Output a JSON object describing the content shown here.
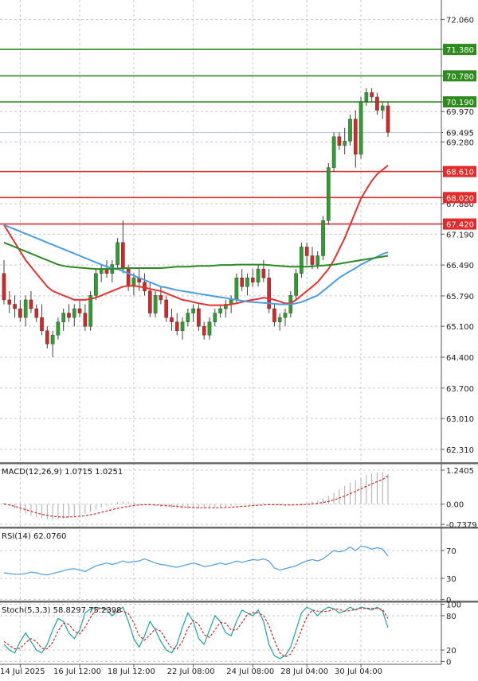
{
  "colors": {
    "background": "#ffffff",
    "grid": "#c8c8c8",
    "bull_candle": "#2ca02c",
    "bear_candle": "#d62728",
    "wick": "#404040",
    "ma_fast": "#e8322e",
    "ma_mid": "#4a9de0",
    "ma_slow": "#2a8a22",
    "resistance_line": "#2e8b1e",
    "support_line": "#e32b2b",
    "current_price_line": "#b8c8dc",
    "macd_hist": "#aaaaaa",
    "macd_signal": "#d62728",
    "rsi_line": "#4a9de0",
    "stoch_k": "#1aa3a3",
    "stoch_d": "#d62728"
  },
  "chart_data": {
    "type": "candlestick",
    "main": {
      "ylim": [
        62.0,
        72.5
      ],
      "y_ticks": [
        "72.060",
        "71.380",
        "70.780",
        "70.190",
        "69.970",
        "69.495",
        "69.280",
        "68.610",
        "68.020",
        "67.880",
        "67.420",
        "67.190",
        "66.490",
        "65.790",
        "65.100",
        "64.400",
        "63.700",
        "63.010",
        "62.310"
      ],
      "y_tick_values": [
        72.06,
        71.38,
        70.78,
        70.19,
        69.97,
        69.495,
        69.28,
        68.61,
        68.02,
        67.88,
        67.42,
        67.19,
        66.49,
        65.79,
        65.1,
        64.4,
        63.7,
        63.01,
        62.31
      ],
      "resistance_levels": [
        {
          "label": "71.380",
          "value": 71.38
        },
        {
          "label": "70.780",
          "value": 70.78
        },
        {
          "label": "70.190",
          "value": 70.19
        }
      ],
      "support_levels": [
        {
          "label": "68.610",
          "value": 68.61
        },
        {
          "label": "68.020",
          "value": 68.02
        },
        {
          "label": "67.420",
          "value": 67.42
        }
      ],
      "current_price": {
        "label": "69.495",
        "value": 69.495
      },
      "candles": [
        [
          66.3,
          66.6,
          65.6,
          65.7
        ],
        [
          65.7,
          65.9,
          65.4,
          65.6
        ],
        [
          65.6,
          65.8,
          65.3,
          65.5
        ],
        [
          65.5,
          65.7,
          65.2,
          65.3
        ],
        [
          65.3,
          65.8,
          65.1,
          65.7
        ],
        [
          65.7,
          65.9,
          65.4,
          65.5
        ],
        [
          65.5,
          65.6,
          65.2,
          65.3
        ],
        [
          65.3,
          65.6,
          64.9,
          65.0
        ],
        [
          65.0,
          65.1,
          64.6,
          64.7
        ],
        [
          64.7,
          65.0,
          64.4,
          64.9
        ],
        [
          64.9,
          65.3,
          64.8,
          65.2
        ],
        [
          65.2,
          65.5,
          65.0,
          65.4
        ],
        [
          65.4,
          65.6,
          65.2,
          65.3
        ],
        [
          65.3,
          65.6,
          65.1,
          65.5
        ],
        [
          65.5,
          65.7,
          65.3,
          65.4
        ],
        [
          65.4,
          65.6,
          65.0,
          65.1
        ],
        [
          65.1,
          65.9,
          65.0,
          65.8
        ],
        [
          65.8,
          66.4,
          65.7,
          66.3
        ],
        [
          66.3,
          66.5,
          66.1,
          66.4
        ],
        [
          66.4,
          66.6,
          66.2,
          66.3
        ],
        [
          66.3,
          66.6,
          66.1,
          66.5
        ],
        [
          66.5,
          67.1,
          66.4,
          67.0
        ],
        [
          67.0,
          67.5,
          66.3,
          66.4
        ],
        [
          66.4,
          66.5,
          65.9,
          66.0
        ],
        [
          66.0,
          66.3,
          65.8,
          66.2
        ],
        [
          66.2,
          66.4,
          65.9,
          66.1
        ],
        [
          66.1,
          66.3,
          65.8,
          65.9
        ],
        [
          65.9,
          66.1,
          65.3,
          65.4
        ],
        [
          65.4,
          65.9,
          65.3,
          65.8
        ],
        [
          65.8,
          66.0,
          65.6,
          65.7
        ],
        [
          65.7,
          65.8,
          65.2,
          65.3
        ],
        [
          65.3,
          65.5,
          65.0,
          65.2
        ],
        [
          65.2,
          65.4,
          64.9,
          65.0
        ],
        [
          65.0,
          65.3,
          64.8,
          65.2
        ],
        [
          65.2,
          65.5,
          65.1,
          65.4
        ],
        [
          65.4,
          65.6,
          65.2,
          65.5
        ],
        [
          65.5,
          65.6,
          65.0,
          65.1
        ],
        [
          65.1,
          65.2,
          64.8,
          64.9
        ],
        [
          64.9,
          65.3,
          64.8,
          65.2
        ],
        [
          65.2,
          65.5,
          65.1,
          65.4
        ],
        [
          65.4,
          65.6,
          65.3,
          65.5
        ],
        [
          65.5,
          65.7,
          65.3,
          65.6
        ],
        [
          65.6,
          65.8,
          65.4,
          65.7
        ],
        [
          65.7,
          66.3,
          65.6,
          66.2
        ],
        [
          66.2,
          66.4,
          65.9,
          66.0
        ],
        [
          66.0,
          66.3,
          65.8,
          66.2
        ],
        [
          66.2,
          66.4,
          66.0,
          66.1
        ],
        [
          66.1,
          66.5,
          66.0,
          66.4
        ],
        [
          66.4,
          66.6,
          66.1,
          66.2
        ],
        [
          66.2,
          66.4,
          65.4,
          65.5
        ],
        [
          65.5,
          65.6,
          65.1,
          65.2
        ],
        [
          65.2,
          65.4,
          65.0,
          65.3
        ],
        [
          65.3,
          65.5,
          65.1,
          65.4
        ],
        [
          65.4,
          65.9,
          65.3,
          65.8
        ],
        [
          65.8,
          66.4,
          65.7,
          66.3
        ],
        [
          66.3,
          67.0,
          66.2,
          66.9
        ],
        [
          66.9,
          67.0,
          66.5,
          66.7
        ],
        [
          66.7,
          66.9,
          66.4,
          66.5
        ],
        [
          66.5,
          66.8,
          66.4,
          66.7
        ],
        [
          66.7,
          67.6,
          66.6,
          67.5
        ],
        [
          67.5,
          68.8,
          67.4,
          68.7
        ],
        [
          68.7,
          69.5,
          68.6,
          69.4
        ],
        [
          69.4,
          69.5,
          69.1,
          69.2
        ],
        [
          69.2,
          69.6,
          69.0,
          69.3
        ],
        [
          69.3,
          69.9,
          69.2,
          69.8
        ],
        [
          69.8,
          70.0,
          68.7,
          69.0
        ],
        [
          69.0,
          70.3,
          68.9,
          70.2
        ],
        [
          70.2,
          70.5,
          70.1,
          70.4
        ],
        [
          70.4,
          70.5,
          70.2,
          70.3
        ],
        [
          70.3,
          70.4,
          69.9,
          70.0
        ],
        [
          70.0,
          70.2,
          69.8,
          70.1
        ],
        [
          70.1,
          70.2,
          69.4,
          69.5
        ]
      ],
      "moving_averages": [
        {
          "key": "ma_fast",
          "values": [
            67.4,
            67.2,
            67.0,
            66.8,
            66.6,
            66.45,
            66.3,
            66.15,
            66.0,
            65.9,
            65.85,
            65.8,
            65.75,
            65.7,
            65.7,
            65.7,
            65.72,
            65.75,
            65.8,
            65.85,
            65.9,
            65.95,
            66.0,
            66.02,
            66.02,
            66.0,
            65.98,
            65.95,
            65.92,
            65.9,
            65.85,
            65.8,
            65.75,
            65.7,
            65.68,
            65.65,
            65.62,
            65.6,
            65.58,
            65.58,
            65.58,
            65.58,
            65.6,
            65.62,
            65.65,
            65.68,
            65.7,
            65.72,
            65.75,
            65.73,
            65.7,
            65.66,
            65.62,
            65.62,
            65.7,
            65.8,
            65.9,
            66.0,
            66.1,
            66.25,
            66.4,
            66.6,
            66.85,
            67.1,
            67.4,
            67.7,
            68.0,
            68.2,
            68.4,
            68.55,
            68.65,
            68.75
          ]
        },
        {
          "key": "ma_mid",
          "values": [
            67.4,
            67.35,
            67.3,
            67.25,
            67.2,
            67.15,
            67.1,
            67.05,
            67.0,
            66.95,
            66.9,
            66.85,
            66.8,
            66.75,
            66.7,
            66.65,
            66.6,
            66.55,
            66.5,
            66.45,
            66.42,
            66.4,
            66.35,
            66.3,
            66.25,
            66.2,
            66.15,
            66.1,
            66.05,
            66.0,
            65.98,
            65.95,
            65.92,
            65.9,
            65.88,
            65.86,
            65.84,
            65.82,
            65.8,
            65.78,
            65.76,
            65.74,
            65.72,
            65.7,
            65.68,
            65.66,
            65.65,
            65.64,
            65.63,
            65.62,
            65.61,
            65.6,
            65.6,
            65.6,
            65.62,
            65.65,
            65.7,
            65.75,
            65.8,
            65.9,
            66.0,
            66.1,
            66.2,
            66.28,
            66.35,
            66.42,
            66.5,
            66.56,
            66.62,
            66.68,
            66.74,
            66.78
          ]
        },
        {
          "key": "ma_slow",
          "values": [
            67.0,
            66.95,
            66.9,
            66.85,
            66.8,
            66.75,
            66.7,
            66.65,
            66.6,
            66.55,
            66.5,
            66.47,
            66.45,
            66.44,
            66.43,
            66.42,
            66.41,
            66.4,
            66.4,
            66.4,
            66.4,
            66.41,
            66.42,
            66.42,
            66.42,
            66.42,
            66.42,
            66.42,
            66.42,
            66.42,
            66.43,
            66.44,
            66.45,
            66.45,
            66.45,
            66.46,
            66.47,
            66.47,
            66.47,
            66.48,
            66.49,
            66.49,
            66.49,
            66.5,
            66.5,
            66.5,
            66.5,
            66.5,
            66.5,
            66.49,
            66.48,
            66.47,
            66.46,
            66.45,
            66.45,
            66.45,
            66.45,
            66.46,
            66.47,
            66.48,
            66.49,
            66.5,
            66.52,
            66.54,
            66.56,
            66.58,
            66.6,
            66.62,
            66.64,
            66.66,
            66.68,
            66.7
          ]
        }
      ]
    },
    "x_ticks": [
      {
        "label": "14 Jul 2025",
        "index": 3
      },
      {
        "label": "16 Jul 12:00",
        "index": 14
      },
      {
        "label": "18 Jul 12:00",
        "index": 24
      },
      {
        "label": "22 Jul 08:00",
        "index": 35
      },
      {
        "label": "24 Jul 08:00",
        "index": 46
      },
      {
        "label": "28 Jul 04:00",
        "index": 56
      },
      {
        "label": "30 Jul 04:00",
        "index": 66
      }
    ],
    "macd": {
      "label": "MACD(12,26,9) 1.0715 1.0251",
      "ylim": [
        -0.85,
        1.5
      ],
      "y_ticks": [
        "1.2405",
        "0.00",
        "-0.7379"
      ],
      "y_tick_values": [
        1.2405,
        0.0,
        -0.7379
      ],
      "hist": [
        0.05,
        -0.05,
        -0.15,
        -0.25,
        -0.35,
        -0.42,
        -0.48,
        -0.52,
        -0.55,
        -0.56,
        -0.55,
        -0.52,
        -0.48,
        -0.44,
        -0.4,
        -0.35,
        -0.28,
        -0.2,
        -0.12,
        -0.05,
        0.02,
        0.08,
        0.1,
        0.08,
        0.05,
        0.02,
        -0.02,
        -0.05,
        -0.08,
        -0.1,
        -0.12,
        -0.14,
        -0.15,
        -0.16,
        -0.17,
        -0.17,
        -0.17,
        -0.16,
        -0.15,
        -0.13,
        -0.11,
        -0.09,
        -0.07,
        -0.04,
        -0.02,
        0.0,
        0.02,
        0.03,
        0.04,
        0.02,
        -0.02,
        -0.05,
        -0.06,
        -0.05,
        -0.02,
        0.02,
        0.06,
        0.1,
        0.14,
        0.2,
        0.3,
        0.42,
        0.54,
        0.66,
        0.78,
        0.88,
        0.98,
        1.06,
        1.12,
        1.16,
        1.18,
        1.1
      ],
      "signal": [
        0.0,
        -0.03,
        -0.08,
        -0.14,
        -0.2,
        -0.26,
        -0.32,
        -0.37,
        -0.41,
        -0.44,
        -0.46,
        -0.47,
        -0.47,
        -0.46,
        -0.44,
        -0.42,
        -0.39,
        -0.35,
        -0.3,
        -0.25,
        -0.2,
        -0.15,
        -0.11,
        -0.08,
        -0.05,
        -0.03,
        -0.02,
        -0.02,
        -0.03,
        -0.04,
        -0.05,
        -0.07,
        -0.08,
        -0.1,
        -0.11,
        -0.12,
        -0.13,
        -0.13,
        -0.13,
        -0.13,
        -0.13,
        -0.12,
        -0.11,
        -0.1,
        -0.08,
        -0.07,
        -0.05,
        -0.04,
        -0.03,
        -0.02,
        -0.02,
        -0.02,
        -0.03,
        -0.03,
        -0.03,
        -0.02,
        -0.01,
        0.01,
        0.03,
        0.06,
        0.1,
        0.15,
        0.22,
        0.3,
        0.38,
        0.47,
        0.56,
        0.65,
        0.74,
        0.82,
        0.9,
        1.0251
      ]
    },
    "rsi": {
      "label": "RSI(14) 62.0760",
      "ylim": [
        -3,
        103
      ],
      "y_ticks": [
        "70",
        "30",
        "0"
      ],
      "y_tick_values": [
        70,
        30,
        0
      ],
      "values": [
        38,
        37,
        36,
        36,
        37,
        39,
        38,
        36,
        35,
        37,
        39,
        41,
        43,
        44,
        42,
        40,
        44,
        48,
        50,
        52,
        50,
        52,
        55,
        53,
        54,
        55,
        58,
        55,
        52,
        50,
        49,
        47,
        46,
        48,
        50,
        52,
        50,
        47,
        48,
        50,
        52,
        50,
        52,
        55,
        53,
        55,
        57,
        56,
        58,
        55,
        45,
        42,
        44,
        46,
        48,
        52,
        55,
        57,
        55,
        58,
        64,
        70,
        68,
        70,
        75,
        70,
        76,
        75,
        72,
        74,
        72,
        62
      ]
    },
    "stoch": {
      "label": "Stoch(5,3,3) 58.8297 75.2398",
      "ylim": [
        -5,
        105
      ],
      "y_ticks": [
        "100",
        "80",
        "20",
        "0"
      ],
      "y_tick_values": [
        100,
        80,
        20,
        0
      ],
      "k": [
        30,
        20,
        15,
        35,
        50,
        35,
        20,
        15,
        30,
        55,
        75,
        70,
        50,
        40,
        55,
        85,
        92,
        95,
        93,
        90,
        80,
        88,
        95,
        70,
        40,
        25,
        45,
        70,
        55,
        35,
        20,
        15,
        30,
        60,
        85,
        70,
        40,
        30,
        55,
        80,
        70,
        50,
        45,
        70,
        90,
        85,
        80,
        90,
        70,
        30,
        10,
        5,
        10,
        25,
        55,
        85,
        95,
        90,
        80,
        90,
        95,
        92,
        85,
        88,
        95,
        90,
        95,
        93,
        90,
        95,
        88,
        59
      ],
      "d": [
        35,
        28,
        22,
        23,
        33,
        40,
        35,
        23,
        22,
        33,
        53,
        67,
        65,
        53,
        48,
        60,
        77,
        91,
        93,
        93,
        88,
        86,
        88,
        84,
        68,
        45,
        37,
        47,
        57,
        53,
        37,
        23,
        22,
        35,
        58,
        72,
        65,
        47,
        42,
        55,
        68,
        67,
        55,
        55,
        68,
        82,
        85,
        85,
        80,
        63,
        37,
        15,
        8,
        13,
        30,
        55,
        78,
        90,
        88,
        87,
        88,
        92,
        91,
        88,
        89,
        91,
        93,
        93,
        93,
        93,
        91,
        75
      ]
    }
  }
}
